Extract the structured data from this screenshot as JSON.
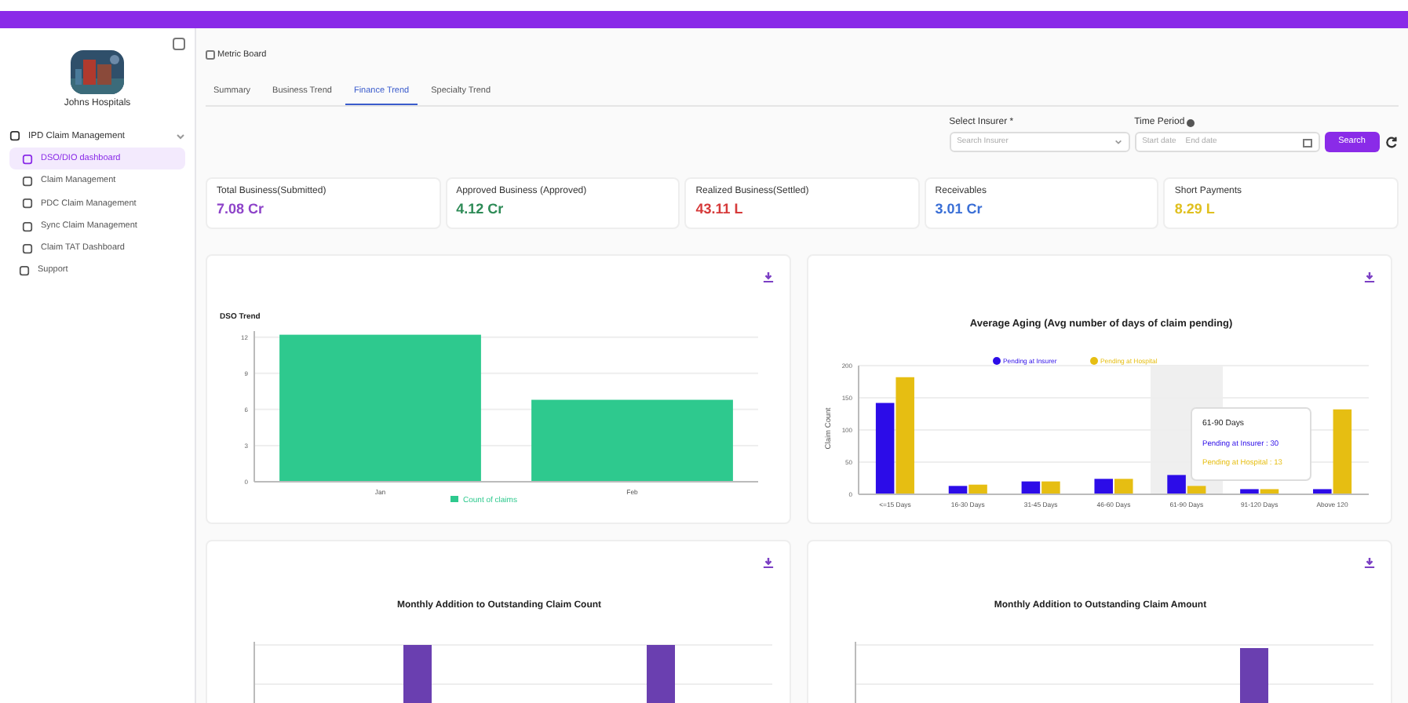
{
  "sidebar": {
    "hospital_name": "Johns Hospitals",
    "menu_group": {
      "label": "IPD Claim Management",
      "expanded": true,
      "items": [
        {
          "label": "DSO/DIO dashboard",
          "selected": true
        },
        {
          "label": "Claim Management",
          "selected": false
        },
        {
          "label": "PDC Claim Management",
          "selected": false
        },
        {
          "label": "Sync Claim Management",
          "selected": false
        },
        {
          "label": "Claim TAT Dashboard",
          "selected": false
        }
      ]
    },
    "support": "Support"
  },
  "page_title": "Metric Board",
  "tabs": [
    {
      "label": "Summary",
      "selected": false
    },
    {
      "label": "Business Trend",
      "selected": false
    },
    {
      "label": "Finance Trend",
      "selected": true
    },
    {
      "label": "Specialty Trend",
      "selected": false
    }
  ],
  "filters": {
    "insurer": {
      "label": "Select Insurer *",
      "placeholder": "Search Insurer"
    },
    "time_period": {
      "label": "Time Period",
      "start_placeholder": "Start date",
      "end_placeholder": "End date"
    },
    "search_button": "Search"
  },
  "kpis": [
    {
      "label": "Total Business(Submitted)",
      "value": "7.08 Cr",
      "color": "#8e44c9"
    },
    {
      "label": "Approved Business (Approved)",
      "value": "4.12 Cr",
      "color": "#2e8b57"
    },
    {
      "label": "Realized Business(Settled)",
      "value": "43.11 L",
      "color": "#d63a3a"
    },
    {
      "label": "Receivables",
      "value": "3.01 Cr",
      "color": "#3a6fd6"
    },
    {
      "label": "Short Payments",
      "value": "8.29 L",
      "color": "#e0c020"
    }
  ],
  "charts": [
    {
      "chart_data": {
        "type": "bar",
        "title": "DSO Trend",
        "categories": [
          "Jan",
          "Feb"
        ],
        "series": [
          {
            "name": "Count of claims",
            "color": "#2ec98e",
            "values": [
              12.2,
              6.8
            ]
          }
        ],
        "ylim": [
          0,
          12.5
        ],
        "yticks": [
          0,
          3,
          6,
          9,
          12
        ],
        "grid": true,
        "legend": true
      }
    },
    {
      "chart_data": {
        "type": "bar",
        "title": "Average Aging (Avg number of days of claim pending)",
        "ylabel": "Claim Count",
        "grid": true,
        "legend": true,
        "categories": [
          "<=15 Days",
          "16-30 Days",
          "31-45 Days",
          "46-60 Days",
          "61-90 Days",
          "91-120 Days",
          "Above 120"
        ],
        "series": [
          {
            "name": "Pending at Insurer",
            "color": "#2c0ce8",
            "values": [
              142,
              13,
              20,
              24,
              30,
              8,
              8
            ]
          },
          {
            "name": "Pending at Hospital",
            "color": "#e6be12",
            "values": [
              182,
              15,
              20,
              24,
              13,
              8,
              132
            ]
          }
        ],
        "ylim": [
          0,
          200
        ],
        "yticks": [
          0,
          50,
          100,
          150,
          200
        ]
      },
      "tooltip": {
        "title": "61-90 Days",
        "lines": [
          "Pending at Insurer : 30",
          "Pending at Hospital : 13"
        ]
      }
    },
    {
      "title": "Monthly Addition to Outstanding Claim Count",
      "kind": "picture"
    },
    {
      "title": "Monthly Addition to Outstanding Claim Amount",
      "kind": "picture"
    }
  ]
}
